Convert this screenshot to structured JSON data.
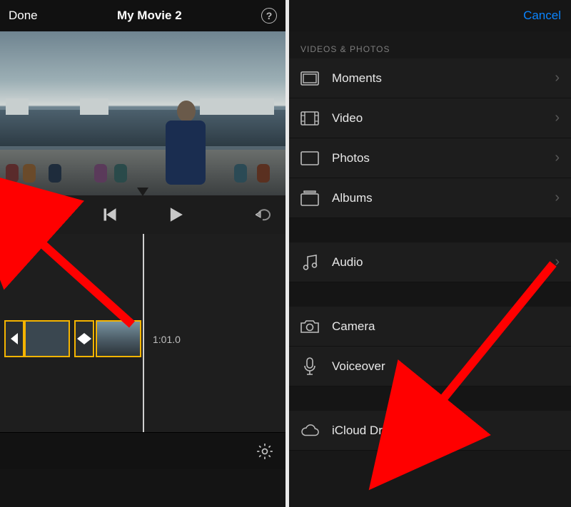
{
  "editor": {
    "done_label": "Done",
    "title": "My Movie 2",
    "help_glyph": "?",
    "timecode": "1:01.0"
  },
  "browser": {
    "cancel_label": "Cancel",
    "section_title": "VIDEOS & PHOTOS",
    "items_media": [
      {
        "label": "Moments",
        "icon": "moments"
      },
      {
        "label": "Video",
        "icon": "video"
      },
      {
        "label": "Photos",
        "icon": "photos"
      },
      {
        "label": "Albums",
        "icon": "albums"
      }
    ],
    "items_audio": [
      {
        "label": "Audio",
        "icon": "audio"
      }
    ],
    "items_capture": [
      {
        "label": "Camera",
        "icon": "camera"
      },
      {
        "label": "Voiceover",
        "icon": "mic"
      }
    ],
    "items_cloud": [
      {
        "label": "iCloud Drive",
        "icon": "cloud"
      }
    ]
  }
}
